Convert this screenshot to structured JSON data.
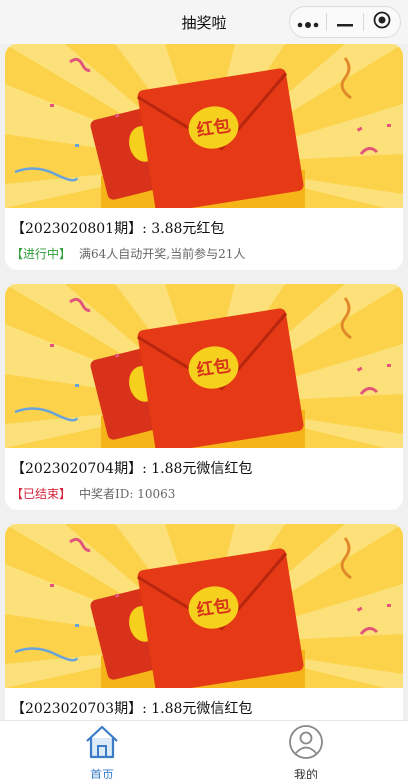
{
  "nav": {
    "title": "抽奖啦"
  },
  "cards": [
    {
      "image_label": "红包",
      "title": "【2023020801期】: 3.88元红包",
      "status": "【进行中】",
      "status_color": "#2f9e3b",
      "info": "满64人自动开奖,当前参与21人"
    },
    {
      "image_label": "红包",
      "title": "【2023020704期】: 1.88元微信红包",
      "status": "【已结束】",
      "status_color": "#d8213b",
      "info": "中奖者ID: 10063"
    },
    {
      "image_label": "红包",
      "title": "【2023020703期】: 1.88元微信红包",
      "status": "",
      "info": ""
    }
  ],
  "tabbar": {
    "items": [
      {
        "label": "首页",
        "icon": "home-icon",
        "active": true
      },
      {
        "label": "我的",
        "icon": "user-icon",
        "active": false
      }
    ]
  },
  "colors": {
    "accent": "#3a7cc8",
    "banner_bg": "#fbd24a",
    "envelope": "#e63a16"
  }
}
